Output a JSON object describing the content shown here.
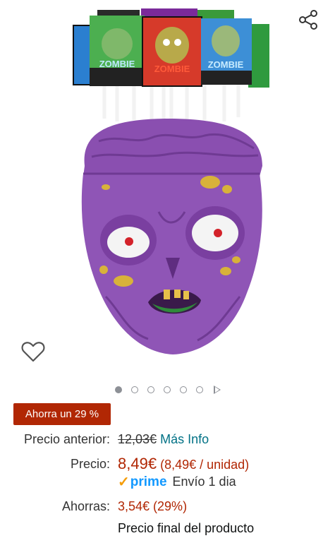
{
  "product": {
    "image_alt": "Purple zombie head candy jar with lollipops"
  },
  "lollipop_labels": [
    "ZOMBIE",
    "ZOMBIE",
    "ZOMBIE"
  ],
  "actions": {
    "share_icon": "share-icon",
    "wishlist_icon": "heart-icon"
  },
  "gallery": {
    "dot_count": 6,
    "active_index": 0,
    "has_video": true
  },
  "deal": {
    "badge": "Ahorra un 29 %"
  },
  "pricing": {
    "previous_label": "Precio anterior:",
    "previous_value": "12,03€",
    "more_info": "Más Info",
    "price_label": "Precio:",
    "price_value": "8,49€",
    "price_unit": "(8,49€ / unidad)",
    "prime_label": "prime",
    "shipping": "Envío 1 dia",
    "savings_label": "Ahorras:",
    "savings_value": "3,54€ (29%)",
    "final_note": "Precio final del producto"
  },
  "colors": {
    "deal_red": "#b12704",
    "link_teal": "#007185",
    "prime_blue": "#1399ff",
    "zombie_purple": "#8a4fb0"
  }
}
